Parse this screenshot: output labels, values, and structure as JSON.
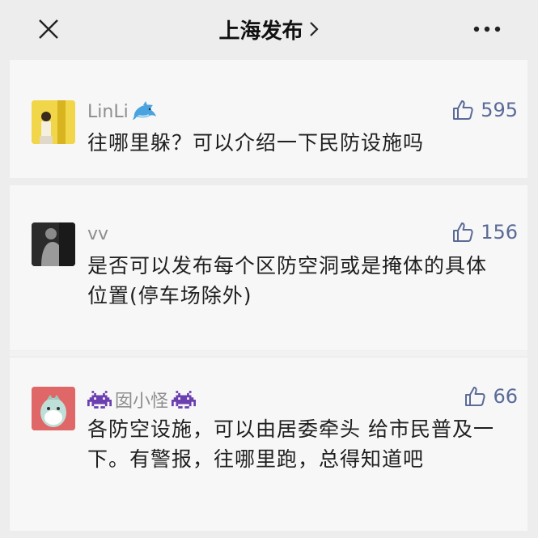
{
  "header": {
    "title": "上海发布",
    "close_icon": "close-icon",
    "more_icon": "more-icon",
    "chevron_icon": "chevron-right-icon"
  },
  "comments": [
    {
      "username": "LinLi",
      "username_emoji": "dolphin",
      "likes": "595",
      "text": "往哪里躲？可以介绍一下民防设施吗"
    },
    {
      "username": "vv",
      "likes": "156",
      "text": "是否可以发布每个区防空洞或是掩体的具体位置(停车场除外)"
    },
    {
      "username": "囡小怪",
      "username_emoji": "space-invader",
      "likes": "66",
      "text": "各防空设施，可以由居委牵头 给市民普及一下。有警报，往哪里跑，总得知道吧"
    }
  ],
  "colors": {
    "page_bg": "#ededed",
    "card_bg": "#f7f7f7",
    "like_blue": "#5b6b98",
    "username_gray": "#8e8e8e"
  }
}
